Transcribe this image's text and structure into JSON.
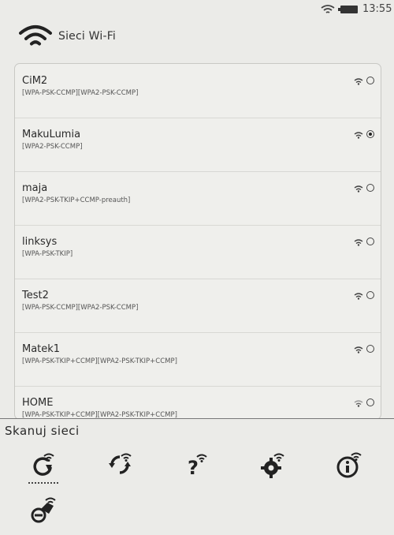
{
  "status": {
    "time": "13:55"
  },
  "header": {
    "title": "Sieci Wi-Fi"
  },
  "networks": [
    {
      "name": "CiM2",
      "security": "[WPA-PSK-CCMP][WPA2-PSK-CCMP]",
      "selected": false
    },
    {
      "name": "MakuLumia",
      "security": "[WPA2-PSK-CCMP]",
      "selected": true
    },
    {
      "name": "maja",
      "security": "[WPA2-PSK-TKIP+CCMP-preauth]",
      "selected": false
    },
    {
      "name": "linksys",
      "security": "[WPA-PSK-TKIP]",
      "selected": false
    },
    {
      "name": "Test2",
      "security": "[WPA-PSK-CCMP][WPA2-PSK-CCMP]",
      "selected": false
    },
    {
      "name": "Matek1",
      "security": "[WPA-PSK-TKIP+CCMP][WPA2-PSK-TKIP+CCMP]",
      "selected": false
    },
    {
      "name": "HOME",
      "security": "[WPA-PSK-TKIP+CCMP][WPA2-PSK-TKIP+CCMP]",
      "selected": false
    }
  ],
  "bottom": {
    "label": "Skanuj sieci",
    "actions": [
      "scan-wifi-icon",
      "refresh-wifi-icon",
      "wifi-help-icon",
      "wifi-settings-icon",
      "wifi-info-icon",
      "disconnect-wifi-icon"
    ]
  }
}
